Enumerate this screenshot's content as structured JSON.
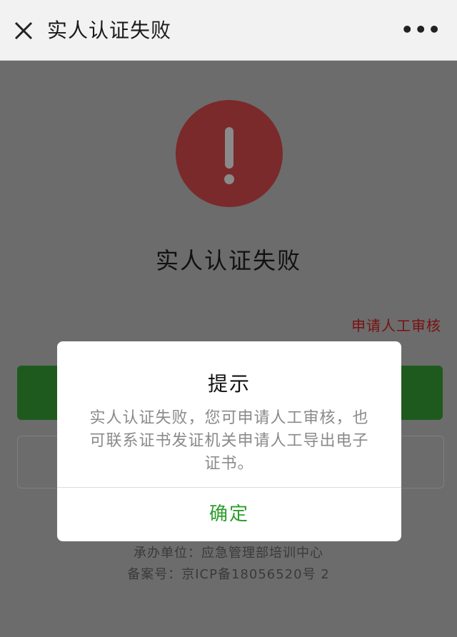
{
  "nav": {
    "title": "实人认证失败",
    "more_label": "•••"
  },
  "result": {
    "heading": "实人认证失败",
    "manual_review_link": "申请人工审核"
  },
  "footer": {
    "line1": "承办单位：应急管理部培训中心",
    "line2": "备案号：京ICP备18056520号 2"
  },
  "dialog": {
    "title": "提示",
    "message": "实人认证失败，您可申请人工审核，也可联系证书发证机关申请人工导出电子证书。",
    "confirm_label": "确定"
  },
  "colors": {
    "ok": "#2e9d2e",
    "alert": "#7a2a2a",
    "link": "#7a1010"
  }
}
